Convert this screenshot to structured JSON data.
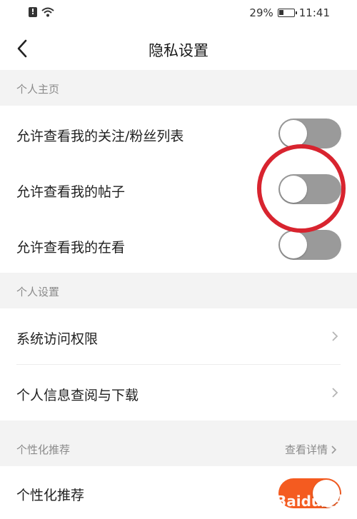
{
  "status_bar": {
    "battery": "29%",
    "battery_level": 0.29,
    "time": "11:41",
    "icons": [
      "alert-icon",
      "wifi-icon",
      "battery-icon"
    ]
  },
  "nav": {
    "back_icon": "chevron-left-icon",
    "title": "隐私设置"
  },
  "sections": {
    "personal_home": {
      "header": "个人主页",
      "items": [
        {
          "label": "允许查看我的关注/粉丝列表",
          "toggle_on": false
        },
        {
          "label": "允许查看我的帖子",
          "toggle_on": false
        },
        {
          "label": "允许查看我的在看",
          "toggle_on": false
        }
      ]
    },
    "personal_settings": {
      "header": "个人设置",
      "items": [
        {
          "label": "系统访问权限"
        },
        {
          "label": "个人信息查阅与下载"
        }
      ]
    },
    "personalized": {
      "header": "个性化推荐",
      "link": "查看详情",
      "items": [
        {
          "label": "个性化推荐",
          "toggle_on": true
        }
      ]
    }
  },
  "colors": {
    "toggle_off": "#9a9a9a",
    "toggle_on": "#f45b20",
    "highlight": "#d8242f",
    "section_bg": "#f3f3f3"
  },
  "watermark": "Baidu经验"
}
